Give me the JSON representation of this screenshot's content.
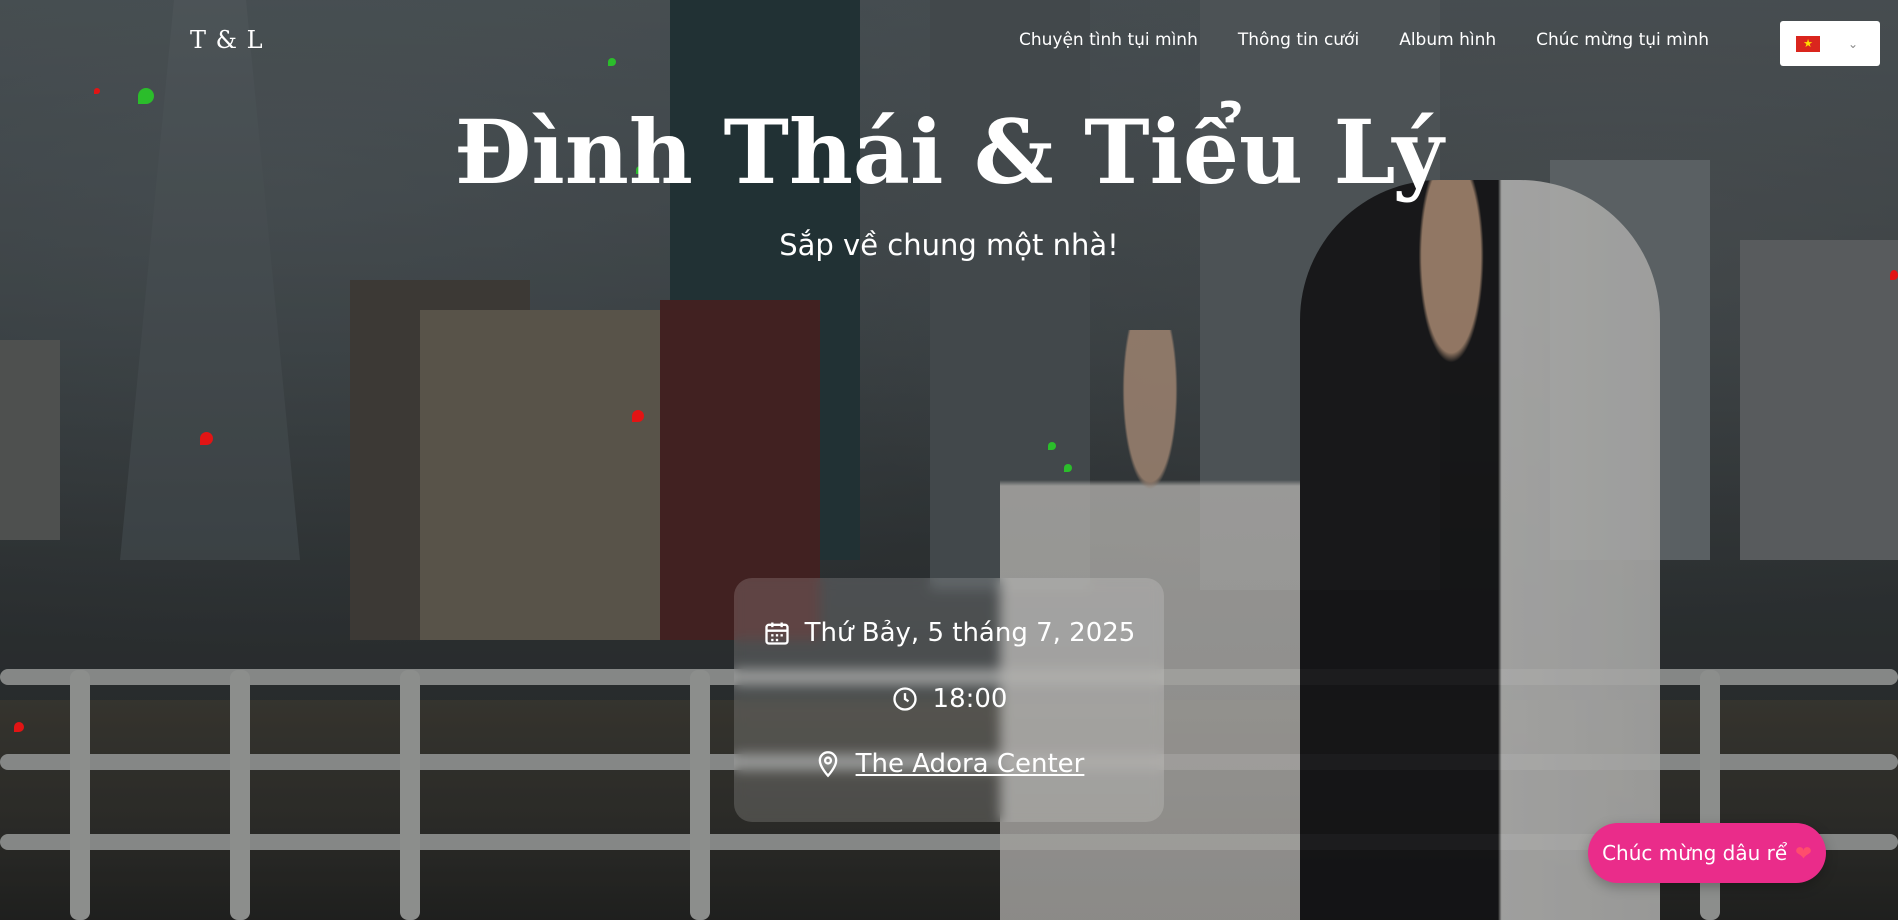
{
  "logo": "T & L",
  "nav": {
    "items": [
      "Chuyện tình tụi mình",
      "Thông tin cưới",
      "Album hình",
      "Chúc mừng tụi mình"
    ]
  },
  "language": {
    "selected_flag": "vietnam-flag-icon",
    "flag_star": "★",
    "chevron": "⌄"
  },
  "hero": {
    "title": "Đình Thái & Tiểu Lý",
    "subtitle": "Sắp về chung một nhà!"
  },
  "event": {
    "date": "Thứ Bảy, 5 tháng 7, 2025",
    "time": "18:00",
    "venue": "The Adora Center"
  },
  "wish_button": {
    "label": "Chúc mừng dâu rể",
    "icon": "heart-icon"
  },
  "colors": {
    "accent": "#ea2c8a",
    "text": "#ffffff",
    "card_bg": "rgba(255,255,255,0.16)"
  }
}
